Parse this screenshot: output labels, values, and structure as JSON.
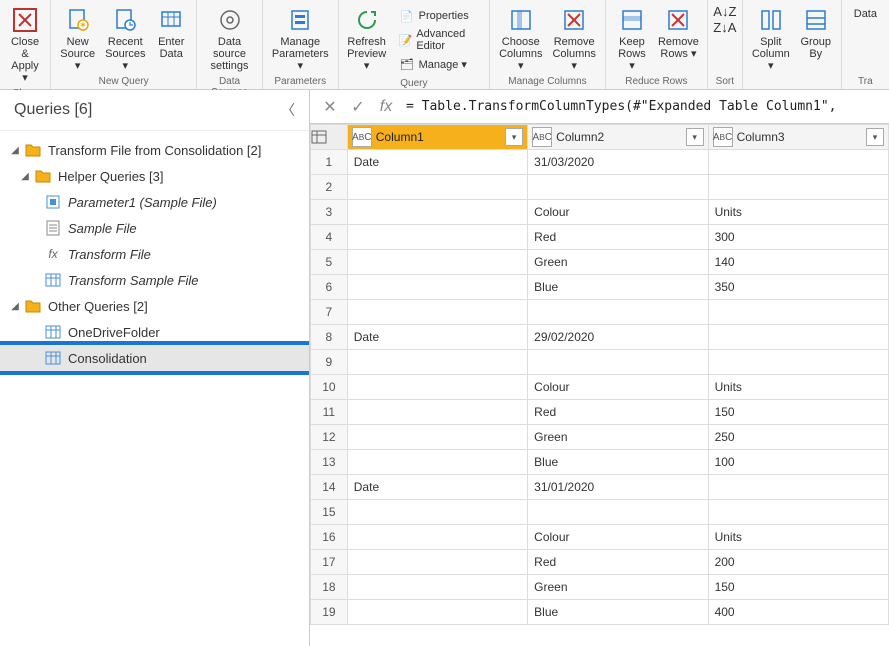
{
  "ribbon": {
    "groups": [
      {
        "label": "Close",
        "buttons": [
          {
            "name": "close-apply",
            "label": "Close &\nApply ▾"
          }
        ]
      },
      {
        "label": "New Query",
        "buttons": [
          {
            "name": "new-source",
            "label": "New\nSource ▾"
          },
          {
            "name": "recent-sources",
            "label": "Recent\nSources ▾"
          },
          {
            "name": "enter-data",
            "label": "Enter\nData"
          }
        ]
      },
      {
        "label": "Data Sources",
        "buttons": [
          {
            "name": "data-source-settings",
            "label": "Data source\nsettings"
          }
        ]
      },
      {
        "label": "Parameters",
        "buttons": [
          {
            "name": "manage-parameters",
            "label": "Manage\nParameters ▾"
          }
        ]
      },
      {
        "label": "Query",
        "buttons": [
          {
            "name": "refresh-preview",
            "label": "Refresh\nPreview ▾"
          }
        ],
        "small": [
          {
            "name": "properties",
            "label": "Properties"
          },
          {
            "name": "advanced-editor",
            "label": "Advanced Editor"
          },
          {
            "name": "manage",
            "label": "Manage ▾"
          }
        ]
      },
      {
        "label": "Manage Columns",
        "buttons": [
          {
            "name": "choose-columns",
            "label": "Choose\nColumns ▾"
          },
          {
            "name": "remove-columns",
            "label": "Remove\nColumns ▾"
          }
        ]
      },
      {
        "label": "Reduce Rows",
        "buttons": [
          {
            "name": "keep-rows",
            "label": "Keep\nRows ▾"
          },
          {
            "name": "remove-rows",
            "label": "Remove\nRows ▾"
          }
        ]
      },
      {
        "label": "Sort",
        "buttons": [
          {
            "name": "sort-asc",
            "label": ""
          },
          {
            "name": "sort-desc",
            "label": ""
          }
        ]
      },
      {
        "label": "",
        "buttons": [
          {
            "name": "split-column",
            "label": "Split\nColumn ▾"
          },
          {
            "name": "group-by",
            "label": "Group\nBy"
          }
        ]
      },
      {
        "label": "Tra",
        "buttons": [
          {
            "name": "data-type",
            "label": "Data"
          }
        ]
      }
    ]
  },
  "queries_panel": {
    "title": "Queries [6]",
    "tree": {
      "group1": {
        "label": "Transform File from Consolidation [2]",
        "expanded": true
      },
      "group1a": {
        "label": "Helper Queries [3]",
        "expanded": true
      },
      "item_param": "Parameter1 (Sample File)",
      "item_sample": "Sample File",
      "item_transform": "Transform File",
      "item_transform_sample": "Transform Sample File",
      "group2": {
        "label": "Other Queries [2]",
        "expanded": true
      },
      "item_onedrive": "OneDriveFolder",
      "item_consolidation": "Consolidation"
    }
  },
  "formula": "= Table.TransformColumnTypes(#\"Expanded Table Column1\",",
  "columns": [
    {
      "name": "Column1",
      "selected": true
    },
    {
      "name": "Column2",
      "selected": false
    },
    {
      "name": "Column3",
      "selected": false
    }
  ],
  "rows": [
    {
      "n": 1,
      "c1": "Date",
      "c2": "31/03/2020",
      "c3": ""
    },
    {
      "n": 2,
      "c1": "",
      "c2": "",
      "c3": ""
    },
    {
      "n": 3,
      "c1": "",
      "c2": "Colour",
      "c3": "Units"
    },
    {
      "n": 4,
      "c1": "",
      "c2": "Red",
      "c3": "300"
    },
    {
      "n": 5,
      "c1": "",
      "c2": "Green",
      "c3": "140"
    },
    {
      "n": 6,
      "c1": "",
      "c2": "Blue",
      "c3": "350"
    },
    {
      "n": 7,
      "c1": "",
      "c2": "",
      "c3": ""
    },
    {
      "n": 8,
      "c1": "Date",
      "c2": "29/02/2020",
      "c3": ""
    },
    {
      "n": 9,
      "c1": "",
      "c2": "",
      "c3": ""
    },
    {
      "n": 10,
      "c1": "",
      "c2": "Colour",
      "c3": "Units"
    },
    {
      "n": 11,
      "c1": "",
      "c2": "Red",
      "c3": "150"
    },
    {
      "n": 12,
      "c1": "",
      "c2": "Green",
      "c3": "250"
    },
    {
      "n": 13,
      "c1": "",
      "c2": "Blue",
      "c3": "100"
    },
    {
      "n": 14,
      "c1": "Date",
      "c2": "31/01/2020",
      "c3": ""
    },
    {
      "n": 15,
      "c1": "",
      "c2": "",
      "c3": ""
    },
    {
      "n": 16,
      "c1": "",
      "c2": "Colour",
      "c3": "Units"
    },
    {
      "n": 17,
      "c1": "",
      "c2": "Red",
      "c3": "200"
    },
    {
      "n": 18,
      "c1": "",
      "c2": "Green",
      "c3": "150"
    },
    {
      "n": 19,
      "c1": "",
      "c2": "Blue",
      "c3": "400"
    }
  ]
}
